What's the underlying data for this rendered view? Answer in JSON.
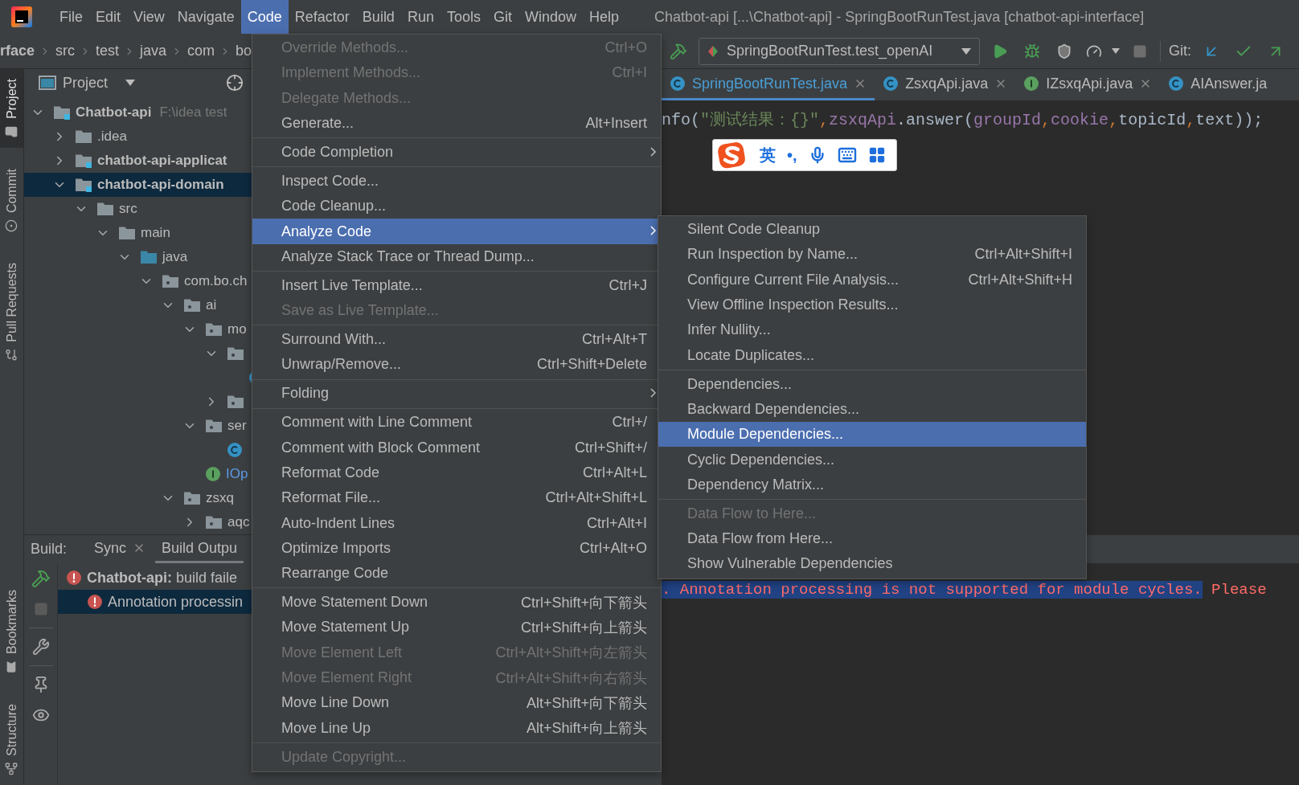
{
  "menu_bar": {
    "items": [
      {
        "label": "File",
        "selected": false
      },
      {
        "label": "Edit",
        "selected": false
      },
      {
        "label": "View",
        "selected": false
      },
      {
        "label": "Navigate",
        "selected": false
      },
      {
        "label": "Code",
        "selected": true
      },
      {
        "label": "Refactor",
        "selected": false
      },
      {
        "label": "Build",
        "selected": false
      },
      {
        "label": "Run",
        "selected": false
      },
      {
        "label": "Tools",
        "selected": false
      },
      {
        "label": "Git",
        "selected": false
      },
      {
        "label": "Window",
        "selected": false
      },
      {
        "label": "Help",
        "selected": false
      }
    ],
    "title": "Chatbot-api [...\\Chatbot-api] - SpringBootRunTest.java [chatbot-api-interface]"
  },
  "breadcrumbs": [
    {
      "label": "rface",
      "kind": "module"
    },
    {
      "label": "src",
      "kind": "folder"
    },
    {
      "label": "test",
      "kind": "folder"
    },
    {
      "label": "java",
      "kind": "folder"
    },
    {
      "label": "com",
      "kind": "folder"
    },
    {
      "label": "bo",
      "kind": "folder"
    }
  ],
  "toolbar": {
    "run_configuration": "SpringBootRunTest.test_openAI",
    "git_label": "Git:"
  },
  "side_stripe": {
    "top": [
      {
        "label": "Project",
        "kind": "project",
        "selected": true
      },
      {
        "label": "Commit",
        "kind": "commit",
        "selected": false
      },
      {
        "label": "Pull Requests",
        "kind": "pull",
        "selected": false
      }
    ],
    "bottom": [
      {
        "label": "Bookmarks",
        "kind": "bookmark",
        "selected": false
      },
      {
        "label": "Structure",
        "kind": "structure",
        "selected": false
      }
    ]
  },
  "project_panel": {
    "title": "Project",
    "tree": [
      {
        "label": "Chatbot-api",
        "path": "F:\\idea test",
        "kind": "module",
        "expanded": true,
        "selected": false,
        "children": [
          {
            "label": ".idea",
            "kind": "folder",
            "expanded": false,
            "selected": false
          },
          {
            "label": "chatbot-api-applicat",
            "kind": "module",
            "expanded": false,
            "selected": false
          },
          {
            "label": "chatbot-api-domain",
            "kind": "module",
            "expanded": true,
            "selected": true,
            "children": [
              {
                "label": "src",
                "kind": "folder",
                "expanded": true,
                "selected": false,
                "children": [
                  {
                    "label": "main",
                    "kind": "folder",
                    "expanded": true,
                    "selected": false,
                    "children": [
                      {
                        "label": "java",
                        "kind": "source-root",
                        "expanded": true,
                        "selected": false,
                        "children": [
                          {
                            "label": "com.bo.ch",
                            "kind": "package",
                            "expanded": true,
                            "selected": false,
                            "children": [
                              {
                                "label": "ai",
                                "kind": "package",
                                "expanded": true,
                                "selected": false,
                                "children": [
                                  {
                                    "label": "mo",
                                    "kind": "package",
                                    "expanded": true,
                                    "selected": false,
                                    "children": [
                                      {
                                        "kind": "package",
                                        "expanded": true,
                                        "selected": false,
                                        "children": [
                                          {
                                            "kind": "class",
                                            "selected": false
                                          }
                                        ]
                                      },
                                      {
                                        "kind": "package",
                                        "expanded": false,
                                        "selected": false
                                      }
                                    ]
                                  },
                                  {
                                    "label": "ser",
                                    "kind": "package",
                                    "expanded": true,
                                    "selected": false,
                                    "children": [
                                      {
                                        "kind": "class",
                                        "selected": false
                                      }
                                    ]
                                  },
                                  {
                                    "label": "IOp",
                                    "kind": "interface",
                                    "selected": false,
                                    "color": "#5c9ce6"
                                  }
                                ]
                              },
                              {
                                "label": "zsxq",
                                "kind": "package",
                                "expanded": true,
                                "selected": false,
                                "children": [
                                  {
                                    "label": "aqc",
                                    "kind": "package",
                                    "expanded": false,
                                    "selected": false
                                  }
                                ]
                              }
                            ]
                          }
                        ]
                      }
                    ]
                  }
                ]
              }
            ]
          }
        ]
      }
    ]
  },
  "editor": {
    "tabs": [
      {
        "label": "SpringBootRunTest.java",
        "kind": "class",
        "selected": true,
        "closable": true,
        "color": "#4a9fd8"
      },
      {
        "label": "ZsxqApi.java",
        "kind": "class",
        "selected": false,
        "closable": true
      },
      {
        "label": "IZsxqApi.java",
        "kind": "interface",
        "selected": false,
        "closable": true
      },
      {
        "label": "AIAnswer.ja",
        "kind": "class",
        "selected": false,
        "closable": false
      }
    ],
    "code_lines": [
      [
        {
          "text": "nfo(",
          "kind": "plain"
        },
        {
          "text": "\"测试结果：{}\"",
          "kind": "string"
        },
        {
          "text": ",",
          "kind": "punct"
        },
        {
          "text": "zsxqApi",
          "kind": "field"
        },
        {
          "text": ".answer(",
          "kind": "plain"
        },
        {
          "text": "groupId",
          "kind": "field"
        },
        {
          "text": ",",
          "kind": "punct"
        },
        {
          "text": "cookie",
          "kind": "field"
        },
        {
          "text": ",",
          "kind": "punct"
        },
        {
          "text": "topicId",
          "kind": "plain"
        },
        {
          "text": ",",
          "kind": "punct"
        },
        {
          "text": "text));",
          "kind": "plain"
        }
      ]
    ]
  },
  "ime_bar": {
    "mode": "英",
    "punctuation": "•,"
  },
  "build_panel": {
    "label": "Build:",
    "tabs": [
      {
        "label": "Sync",
        "selected": false,
        "closable": true
      },
      {
        "label": "Build Outpu",
        "selected": true,
        "closable": false
      }
    ],
    "tree": [
      {
        "text": "**Chatbot-api:** build faile",
        "kind": "error",
        "selected": false,
        "children": [
          {
            "text": "Annotation processin",
            "kind": "error",
            "selected": true
          }
        ]
      }
    ],
    "console": [
      {
        "text": ". Annotation processing is not supported for module cycles.",
        "highlighted": true
      },
      {
        "text": " Please",
        "highlighted": false
      }
    ]
  },
  "code_menu": {
    "items": [
      {
        "kind": "item",
        "label": "Override Methods...",
        "shortcut": "Ctrl+O",
        "disabled": true,
        "selected": false
      },
      {
        "kind": "item",
        "label": "Implement Methods...",
        "shortcut": "Ctrl+I",
        "disabled": true,
        "selected": false
      },
      {
        "kind": "item",
        "label": "Delegate Methods...",
        "disabled": true,
        "selected": false
      },
      {
        "kind": "item",
        "label": "Generate...",
        "shortcut": "Alt+Insert",
        "disabled": false,
        "selected": false
      },
      {
        "kind": "separator"
      },
      {
        "kind": "item",
        "label": "Code Completion",
        "submenu": true,
        "disabled": false,
        "selected": false
      },
      {
        "kind": "separator"
      },
      {
        "kind": "item",
        "label": "Inspect Code...",
        "disabled": false,
        "selected": false
      },
      {
        "kind": "item",
        "label": "Code Cleanup...",
        "disabled": false,
        "selected": false
      },
      {
        "kind": "item",
        "label": "Analyze Code",
        "submenu": true,
        "disabled": false,
        "selected": true
      },
      {
        "kind": "item",
        "label": "Analyze Stack Trace or Thread Dump...",
        "disabled": false,
        "selected": false
      },
      {
        "kind": "separator"
      },
      {
        "kind": "item",
        "label": "Insert Live Template...",
        "shortcut": "Ctrl+J",
        "disabled": false,
        "selected": false
      },
      {
        "kind": "item",
        "label": "Save as Live Template...",
        "disabled": true,
        "selected": false
      },
      {
        "kind": "separator"
      },
      {
        "kind": "item",
        "label": "Surround With...",
        "shortcut": "Ctrl+Alt+T",
        "disabled": false,
        "selected": false
      },
      {
        "kind": "item",
        "label": "Unwrap/Remove...",
        "shortcut": "Ctrl+Shift+Delete",
        "disabled": false,
        "selected": false
      },
      {
        "kind": "separator"
      },
      {
        "kind": "item",
        "label": "Folding",
        "submenu": true,
        "disabled": false,
        "selected": false
      },
      {
        "kind": "separator"
      },
      {
        "kind": "item",
        "label": "Comment with Line Comment",
        "shortcut": "Ctrl+/",
        "disabled": false,
        "selected": false
      },
      {
        "kind": "item",
        "label": "Comment with Block Comment",
        "shortcut": "Ctrl+Shift+/",
        "disabled": false,
        "selected": false
      },
      {
        "kind": "item",
        "label": "Reformat Code",
        "shortcut": "Ctrl+Alt+L",
        "disabled": false,
        "selected": false
      },
      {
        "kind": "item",
        "label": "Reformat File...",
        "shortcut": "Ctrl+Alt+Shift+L",
        "disabled": false,
        "selected": false
      },
      {
        "kind": "item",
        "label": "Auto-Indent Lines",
        "shortcut": "Ctrl+Alt+I",
        "disabled": false,
        "selected": false
      },
      {
        "kind": "item",
        "label": "Optimize Imports",
        "shortcut": "Ctrl+Alt+O",
        "disabled": false,
        "selected": false
      },
      {
        "kind": "item",
        "label": "Rearrange Code",
        "disabled": false,
        "selected": false
      },
      {
        "kind": "separator"
      },
      {
        "kind": "item",
        "label": "Move Statement Down",
        "shortcut": "Ctrl+Shift+向下箭头",
        "disabled": false,
        "selected": false
      },
      {
        "kind": "item",
        "label": "Move Statement Up",
        "shortcut": "Ctrl+Shift+向上箭头",
        "disabled": false,
        "selected": false
      },
      {
        "kind": "item",
        "label": "Move Element Left",
        "shortcut": "Ctrl+Alt+Shift+向左箭头",
        "disabled": true,
        "selected": false
      },
      {
        "kind": "item",
        "label": "Move Element Right",
        "shortcut": "Ctrl+Alt+Shift+向右箭头",
        "disabled": true,
        "selected": false
      },
      {
        "kind": "item",
        "label": "Move Line Down",
        "shortcut": "Alt+Shift+向下箭头",
        "disabled": false,
        "selected": false
      },
      {
        "kind": "item",
        "label": "Move Line Up",
        "shortcut": "Alt+Shift+向上箭头",
        "disabled": false,
        "selected": false
      },
      {
        "kind": "separator"
      },
      {
        "kind": "item",
        "label": "Update Copyright...",
        "disabled": true,
        "selected": false
      }
    ]
  },
  "analyze_submenu": {
    "items": [
      {
        "kind": "item",
        "label": "Silent Code Cleanup",
        "disabled": false,
        "selected": false
      },
      {
        "kind": "item",
        "label": "Run Inspection by Name...",
        "shortcut": "Ctrl+Alt+Shift+I",
        "disabled": false,
        "selected": false
      },
      {
        "kind": "item",
        "label": "Configure Current File Analysis...",
        "shortcut": "Ctrl+Alt+Shift+H",
        "disabled": false,
        "selected": false
      },
      {
        "kind": "item",
        "label": "View Offline Inspection Results...",
        "disabled": false,
        "selected": false
      },
      {
        "kind": "item",
        "label": "Infer Nullity...",
        "disabled": false,
        "selected": false
      },
      {
        "kind": "item",
        "label": "Locate Duplicates...",
        "disabled": false,
        "selected": false
      },
      {
        "kind": "separator"
      },
      {
        "kind": "item",
        "label": "Dependencies...",
        "disabled": false,
        "selected": false
      },
      {
        "kind": "item",
        "label": "Backward Dependencies...",
        "disabled": false,
        "selected": false
      },
      {
        "kind": "item",
        "label": "Module Dependencies...",
        "disabled": false,
        "selected": true
      },
      {
        "kind": "item",
        "label": "Cyclic Dependencies...",
        "disabled": false,
        "selected": false
      },
      {
        "kind": "item",
        "label": "Dependency Matrix...",
        "disabled": false,
        "selected": false
      },
      {
        "kind": "separator"
      },
      {
        "kind": "item",
        "label": "Data Flow to Here...",
        "disabled": true,
        "selected": false
      },
      {
        "kind": "item",
        "label": "Data Flow from Here...",
        "disabled": false,
        "selected": false
      },
      {
        "kind": "item",
        "label": "Show Vulnerable Dependencies",
        "disabled": false,
        "selected": false
      }
    ]
  }
}
